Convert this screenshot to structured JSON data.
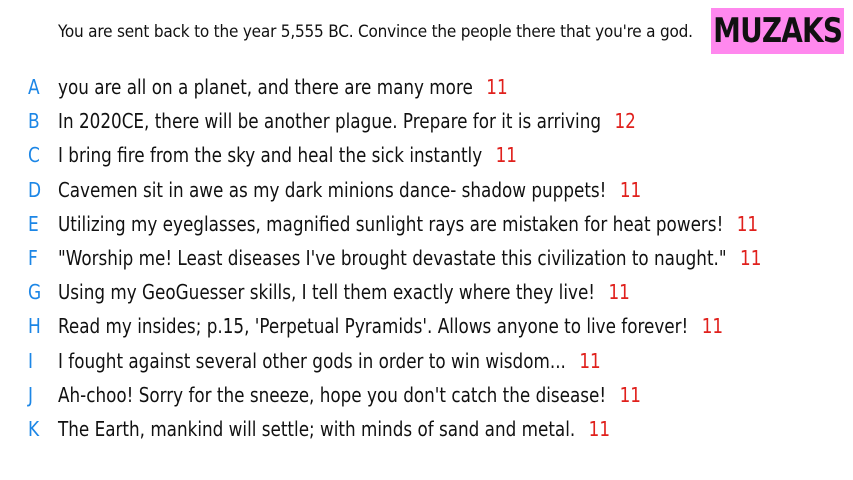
{
  "prompt": "You are sent back to the year 5,555 BC. Convince the people there that you're a god.",
  "logo": "MUZAKS",
  "colors": {
    "letter": "#1c86e6",
    "score": "#e0201c",
    "logo_bg": "#ff88ee",
    "text": "#111111"
  },
  "answers": [
    {
      "letter": "A",
      "text": "you are all on a planet, and there are many more",
      "score": "11"
    },
    {
      "letter": "B",
      "text": "In 2020CE, there will be another plague. Prepare for it is arriving",
      "score": "12"
    },
    {
      "letter": "C",
      "text": "I bring fire from the sky and heal the sick instantly",
      "score": "11"
    },
    {
      "letter": "D",
      "text": "Cavemen sit in awe as my dark minions dance- shadow puppets!",
      "score": "11"
    },
    {
      "letter": "E",
      "text": "Utilizing my eyeglasses, magnified sunlight rays are mistaken for heat powers!",
      "score": "11"
    },
    {
      "letter": "F",
      "text": "\"Worship me! Least diseases I've brought devastate this civilization to naught.\"",
      "score": "11"
    },
    {
      "letter": "G",
      "text": "Using my GeoGuesser skills, I tell them exactly where they live!",
      "score": "11"
    },
    {
      "letter": "H",
      "text": "Read my insides; p.15, 'Perpetual Pyramids'. Allows anyone to live forever!",
      "score": "11"
    },
    {
      "letter": "I",
      "text": "I fought against several other gods in order to win wisdom...",
      "score": "11"
    },
    {
      "letter": "J",
      "text": "Ah-choo! Sorry for the sneeze, hope you don't catch the disease!",
      "score": "11"
    },
    {
      "letter": "K",
      "text": "The Earth, mankind will settle; with minds of sand and metal.",
      "score": "11"
    }
  ]
}
